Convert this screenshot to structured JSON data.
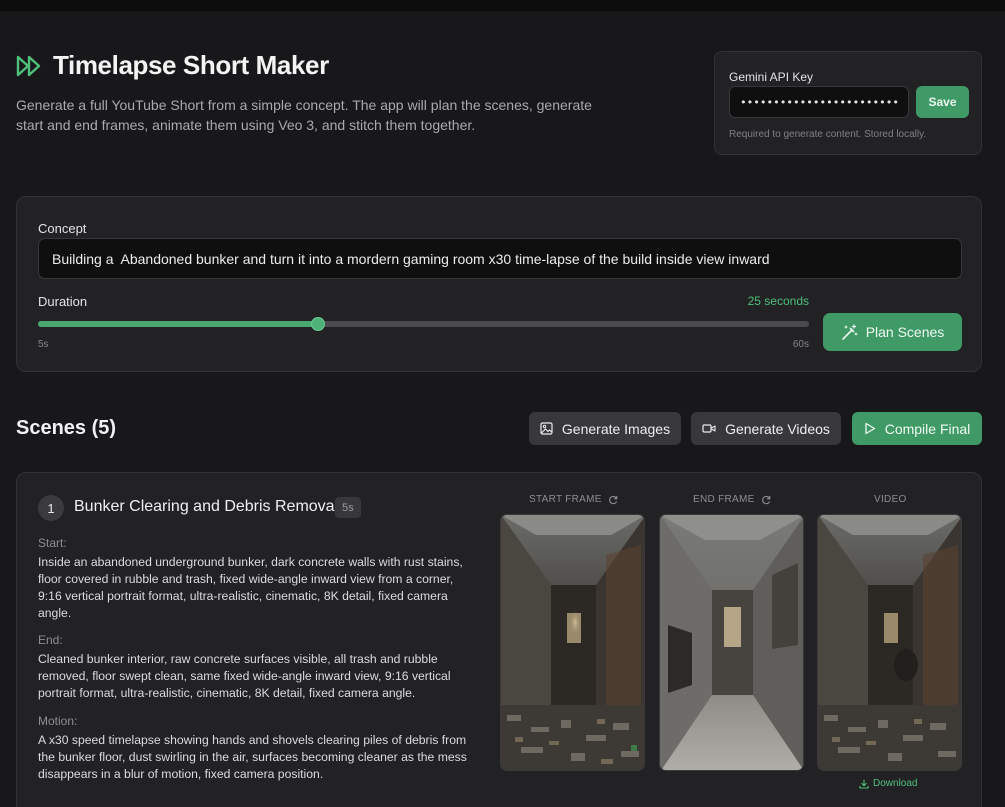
{
  "app": {
    "title": "Timelapse Short Maker",
    "description": "Generate a full YouTube Short from a simple concept. The app will plan the scenes, generate start and end frames, animate them using Veo 3, and stitch them together.",
    "icon": "fast-forward-icon",
    "accent_color": "#3f9a66"
  },
  "api_key": {
    "label": "Gemini API Key",
    "value": "••••••••••••••••••••••••••••••",
    "save_label": "Save",
    "hint": "Required to generate content. Stored locally."
  },
  "concept": {
    "label": "Concept",
    "value": "Building a  Abandoned bunker and turn it into a mordern gaming room x30 time-lapse of the build inside view inward"
  },
  "duration": {
    "label": "Duration",
    "value_text": "25 seconds",
    "value": 25,
    "min": 5,
    "max": 60,
    "min_label": "5s",
    "max_label": "60s"
  },
  "plan_button": {
    "label": "Plan Scenes",
    "icon": "magic-wand-icon"
  },
  "scenes": {
    "title": "Scenes (5)",
    "actions": {
      "generate_images": {
        "label": "Generate Images",
        "icon": "image-icon"
      },
      "generate_videos": {
        "label": "Generate Videos",
        "icon": "video-camera-icon"
      },
      "compile_final": {
        "label": "Compile Final",
        "icon": "play-icon"
      }
    },
    "items": [
      {
        "number": "1",
        "title": "Bunker Clearing and Debris Removal",
        "duration": "5s",
        "start_label": "Start:",
        "start_text": "Inside an abandoned underground bunker, dark concrete walls with rust stains, floor covered in rubble and trash, fixed wide-angle inward view from a corner, 9:16 vertical portrait format, ultra-realistic, cinematic, 8K detail, fixed camera angle.",
        "end_label": "End:",
        "end_text": "Cleaned bunker interior, raw concrete surfaces visible, all trash and rubble removed, floor swept clean, same fixed wide-angle inward view, 9:16 vertical portrait format, ultra-realistic, cinematic, 8K detail, fixed camera angle.",
        "motion_label": "Motion:",
        "motion_text": "A x30 speed timelapse showing hands and shovels clearing piles of debris from the bunker floor, dust swirling in the air, surfaces becoming cleaner as the mess disappears in a blur of motion, fixed camera position.",
        "start_frame_label": "START FRAME",
        "end_frame_label": "END FRAME",
        "video_label": "VIDEO",
        "download_label": "Download"
      }
    ]
  }
}
